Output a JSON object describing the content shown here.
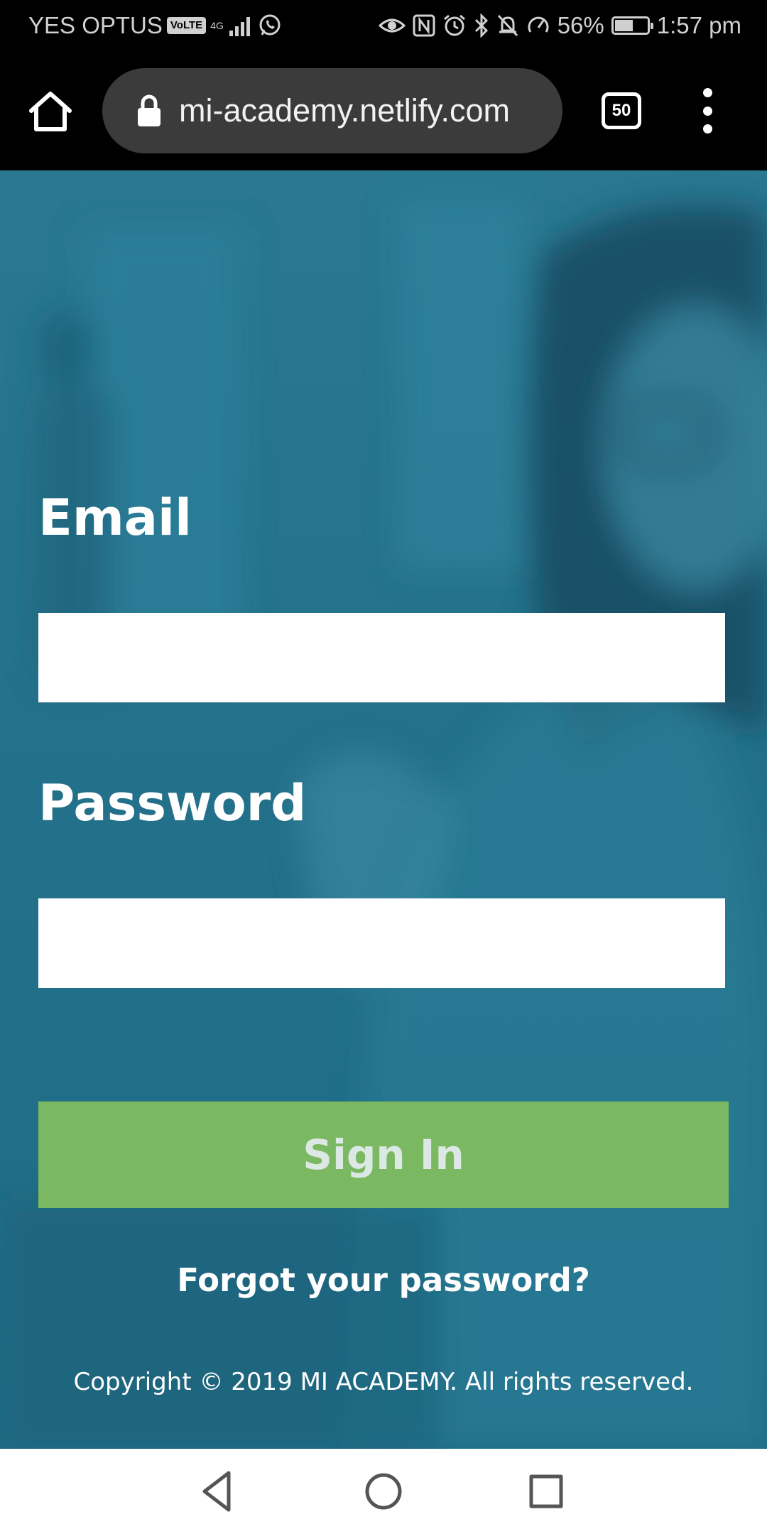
{
  "status_bar": {
    "carrier": "YES OPTUS",
    "volte": "VoLTE",
    "network": "4G",
    "battery_percent": "56%",
    "battery_level": 0.56,
    "time": "1:57 pm"
  },
  "browser": {
    "url": "mi-academy.netlify.com",
    "tab_count": "50"
  },
  "form": {
    "email_label": "Email",
    "email_value": "",
    "password_label": "Password",
    "password_value": "",
    "signin_label": "Sign In",
    "forgot_link": "Forgot your password?"
  },
  "footer": {
    "copyright": "Copyright © 2019 MI ACADEMY. All rights reserved."
  },
  "colors": {
    "overlay": "#27758f",
    "signin_button": "#7ab861",
    "signin_text": "#dbe8e3"
  },
  "icons": {
    "home": "home-icon",
    "lock": "lock-icon",
    "menu": "more-vert-icon",
    "nav_back": "back-icon",
    "nav_home": "home-circle-icon",
    "nav_recents": "recents-icon"
  }
}
